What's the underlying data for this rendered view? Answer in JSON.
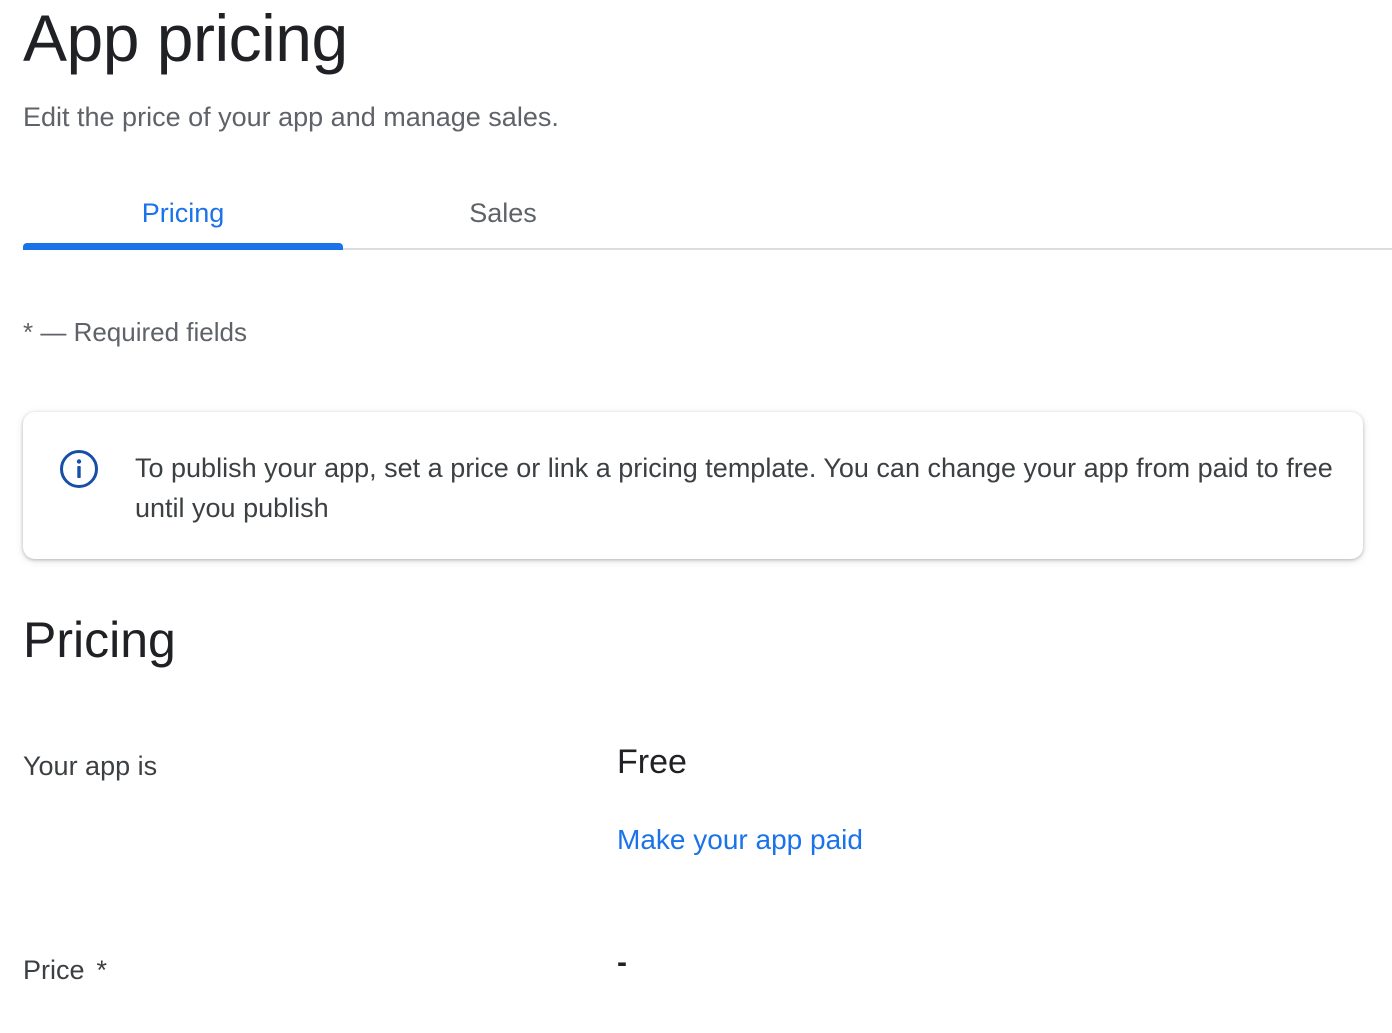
{
  "header": {
    "title": "App pricing",
    "subtitle": "Edit the price of your app and manage sales."
  },
  "tabs": [
    {
      "label": "Pricing",
      "active": true
    },
    {
      "label": "Sales",
      "active": false
    }
  ],
  "required_note": "* — Required fields",
  "info_banner": {
    "icon": "info-icon",
    "text": "To publish your app, set a price or link a pricing template. You can change your app from paid to free until you publish"
  },
  "pricing_section": {
    "title": "Pricing",
    "app_is_label": "Your app is",
    "app_status": "Free",
    "make_paid_link": "Make your app paid",
    "price_label": "Price",
    "price_required_marker": "*",
    "price_value": "-"
  },
  "colors": {
    "accent": "#1a73e8",
    "info_icon": "#174ea6",
    "text_primary": "#202124",
    "text_secondary": "#5f6368"
  }
}
